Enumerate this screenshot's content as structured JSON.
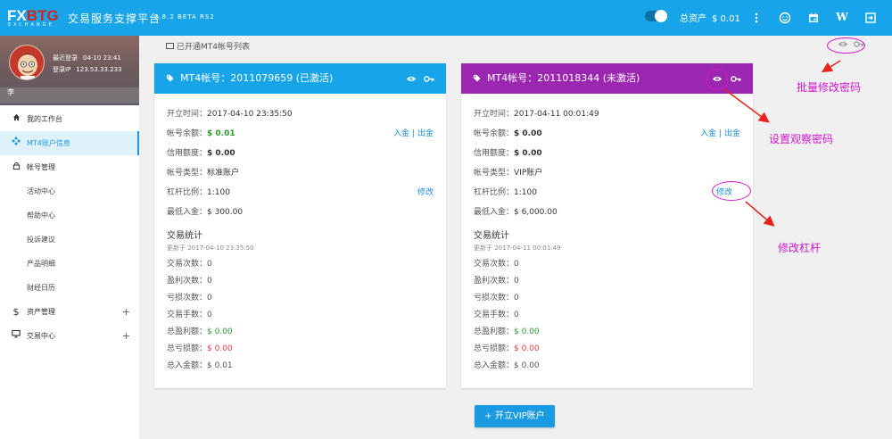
{
  "brand": {
    "logo_main": "FX",
    "logo_accent": "BTG",
    "logo_sub": "EXCHANGE"
  },
  "header": {
    "title": "交易服务支撑平台",
    "version": "0.8.2 BETA RS2",
    "assets_label": "总资产",
    "assets_value": "$ 0.01",
    "icons": [
      "more-vert-icon",
      "smiley-icon",
      "calendar-icon",
      "w-icon",
      "exit-icon"
    ]
  },
  "profile": {
    "last_login_label": "最近登录",
    "last_login_value": "04-10 23:41",
    "ip_label": "登录IP",
    "ip_value": "123.53.33.233",
    "username": "李"
  },
  "sidebar": {
    "items": [
      {
        "label": "我的工作台",
        "icon": "home-icon"
      },
      {
        "label": "MT4账户信息",
        "icon": "share-icon"
      },
      {
        "label": "帐号管理",
        "icon": "lock-icon"
      },
      {
        "label": "活动中心"
      },
      {
        "label": "帮助中心"
      },
      {
        "label": "投诉建议"
      },
      {
        "label": "产品明细"
      },
      {
        "label": "财经日历"
      },
      {
        "label": "资产管理",
        "icon": "dollar-icon",
        "expand": "+"
      },
      {
        "label": "交易中心",
        "icon": "monitor-icon",
        "expand": "+"
      }
    ]
  },
  "breadcrumb": "已开通MT4帐号列表",
  "cards": [
    {
      "title": "MT4帐号：2011079659 (已激活)",
      "color": "#18a4e8",
      "open_label": "开立时间：",
      "open_value": "2017-04-10 23:35:50",
      "balance_label": "帐号余额：",
      "balance_value": "$ 0.01",
      "deposit": "入金",
      "sep": "|",
      "withdraw": "出金",
      "credit_label": "信用额度：",
      "credit_value": "$ 0.00",
      "type_label": "帐号类型：",
      "type_value": "标准账户",
      "leverage_label": "杠杆比例：",
      "leverage_value": "1:100",
      "modify": "修改",
      "min_label": "最低入金：",
      "min_value": "$ 300.00",
      "stats_title": "交易统计",
      "updated": "更新于 2017-04-10 23:35:50",
      "trades_label": "交易次数：",
      "trades": "0",
      "wins_label": "盈利次数：",
      "wins": "0",
      "losses_label": "亏损次数：",
      "losses": "0",
      "lots_label": "交易手数：",
      "lots": "0",
      "profit_label": "总盈利额：",
      "profit": "$ 0.00",
      "loss_label": "总亏损额：",
      "loss": "$ 0.00",
      "deposit_total_label": "总入金额：",
      "deposit_total": "$ 0.01"
    },
    {
      "title": "MT4帐号：2011018344 (未激活)",
      "color": "#9b27b0",
      "open_label": "开立时间：",
      "open_value": "2017-04-11 00:01:49",
      "balance_label": "帐号余额：",
      "balance_value": "$ 0.00",
      "deposit": "入金",
      "sep": "|",
      "withdraw": "出金",
      "credit_label": "信用额度：",
      "credit_value": "$ 0.00",
      "type_label": "帐号类型：",
      "type_value": "VIP账户",
      "leverage_label": "杠杆比例：",
      "leverage_value": "1:100",
      "modify": "修改",
      "min_label": "最低入金：",
      "min_value": "$ 6,000.00",
      "stats_title": "交易统计",
      "updated": "更新于 2017-04-11 00:01:49",
      "trades_label": "交易次数：",
      "trades": "0",
      "wins_label": "盈利次数：",
      "wins": "0",
      "losses_label": "亏损次数：",
      "losses": "0",
      "lots_label": "交易手数：",
      "lots": "0",
      "profit_label": "总盈利额：",
      "profit": "$ 0.00",
      "loss_label": "总亏损额：",
      "loss": "$ 0.00",
      "deposit_total_label": "总入金额：",
      "deposit_total": "$ 0.00"
    }
  ],
  "vip_button": "+ 开立VIP账户",
  "annotations": {
    "batch": "批量修改密码",
    "watch": "设置观察密码",
    "leverage": "修改杠杆"
  },
  "colors": {
    "primary": "#18a4e8",
    "inactive": "#9b27b0",
    "annotation": "#d415d0",
    "positive": "#2a9b2a",
    "negative": "#e23b3b"
  }
}
